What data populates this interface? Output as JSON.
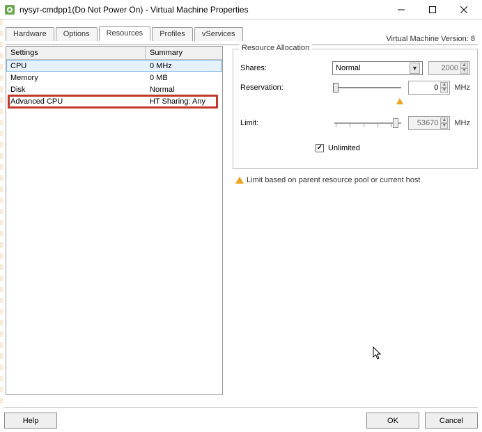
{
  "window": {
    "title": "nysyr-cmdpp1(Do Not Power On) - Virtual Machine Properties"
  },
  "version_label": "Virtual Machine Version: 8",
  "tabs": [
    {
      "label": "Hardware"
    },
    {
      "label": "Options"
    },
    {
      "label": "Resources"
    },
    {
      "label": "Profiles"
    },
    {
      "label": "vServices"
    }
  ],
  "grid": {
    "headers": {
      "col1": "Settings",
      "col2": "Summary"
    },
    "rows": [
      {
        "c1": "CPU",
        "c2": "0 MHz",
        "selected": true
      },
      {
        "c1": "Memory",
        "c2": "0 MB"
      },
      {
        "c1": "Disk",
        "c2": "Normal"
      },
      {
        "c1": "Advanced CPU",
        "c2": "HT Sharing: Any"
      }
    ]
  },
  "allocation": {
    "legend": "Resource Allocation",
    "shares_label": "Shares:",
    "shares_value": "Normal",
    "shares_num": "2000",
    "reservation_label": "Reservation:",
    "reservation_value": "0",
    "reservation_unit": "MHz",
    "limit_label": "Limit:",
    "limit_value": "53670",
    "limit_unit": "MHz",
    "unlimited_label": "Unlimited",
    "note": "Limit based on parent resource pool or current host"
  },
  "buttons": {
    "help": "Help",
    "ok": "OK",
    "cancel": "Cancel"
  }
}
